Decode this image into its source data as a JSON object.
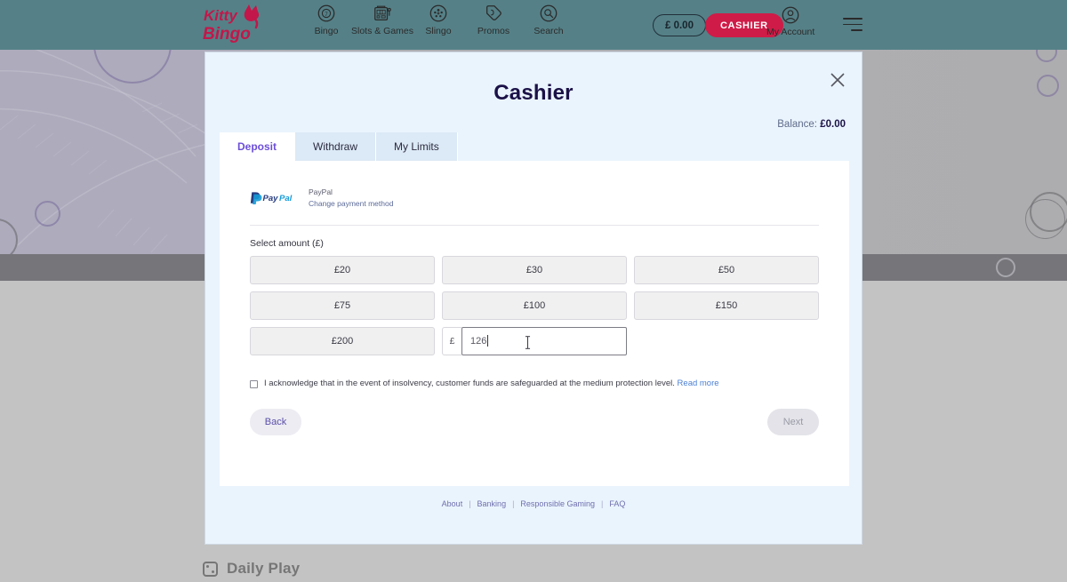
{
  "header": {
    "logo_line1": "Kitty",
    "logo_line2": "Bingo",
    "nav": [
      {
        "label": "Bingo",
        "icon": "bingo-ball-icon"
      },
      {
        "label": "Slots & Games",
        "icon": "slot-machine-icon"
      },
      {
        "label": "Slingo",
        "icon": "slingo-icon"
      },
      {
        "label": "Promos",
        "icon": "promos-tag-icon"
      },
      {
        "label": "Search",
        "icon": "search-icon"
      }
    ],
    "balance_pill": "£ 0.00",
    "cashier_button": "CASHIER",
    "account_label": "My Account"
  },
  "modal": {
    "title": "Cashier",
    "balance_label": "Balance:",
    "balance_value": "£0.00",
    "close_icon": "close-icon",
    "tabs": [
      {
        "label": "Deposit",
        "active": true
      },
      {
        "label": "Withdraw",
        "active": false
      },
      {
        "label": "My Limits",
        "active": false
      }
    ],
    "payment": {
      "logo": "paypal-logo",
      "name": "PayPal",
      "change_link": "Change payment method"
    },
    "select_amount_label": "Select amount (£)",
    "amounts": [
      "£20",
      "£30",
      "£50",
      "£75",
      "£100",
      "£150",
      "£200"
    ],
    "custom_amount": {
      "currency": "£",
      "value": "126",
      "placeholder": ""
    },
    "acknowledgement": {
      "text": "I acknowledge that in the event of insolvency, customer funds are safeguarded at the medium protection level.",
      "read_more": "Read more",
      "checked": false
    },
    "buttons": {
      "back": "Back",
      "next": "Next"
    },
    "footer_links": [
      "About",
      "Banking",
      "Responsible Gaming",
      "FAQ"
    ],
    "footer_separator": "|"
  },
  "background": {
    "daily_play": "Daily Play"
  },
  "colors": {
    "header_bg": "#558087",
    "cashier_red": "#cf1b47",
    "modal_bg": "#eaf4fd",
    "accent_purple": "#6c4ed8",
    "title_navy": "#1b1147"
  }
}
